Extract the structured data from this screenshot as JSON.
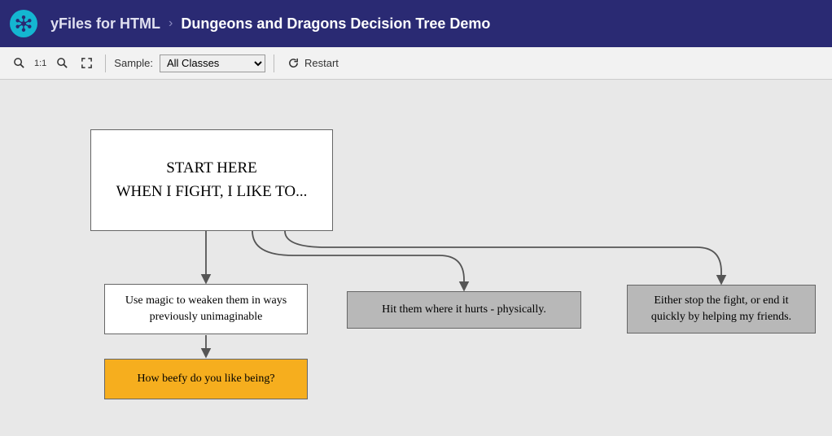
{
  "header": {
    "product": "yFiles for HTML",
    "demo": "Dungeons and Dragons Decision Tree Demo"
  },
  "toolbar": {
    "zoom_1_1": "1:1",
    "sample_label": "Sample:",
    "sample_selected": "All Classes",
    "restart_label": "Restart"
  },
  "nodes": {
    "start_l1": "START HERE",
    "start_l2": "WHEN I FIGHT, I LIKE TO...",
    "opt_magic_l1": "Use magic to weaken them in ways",
    "opt_magic_l2": "previously unimaginable",
    "opt_hit": "Hit them where it hurts - physically.",
    "opt_stop_l1": "Either stop the fight, or end it",
    "opt_stop_l2": "quickly by helping my friends.",
    "q_beefy": "How beefy do you like being?"
  },
  "colors": {
    "header_bg": "#2a2a73",
    "logo_bg": "#14b6d1",
    "node_orange": "#f6ae1e",
    "node_gray": "#b8b8b8"
  }
}
